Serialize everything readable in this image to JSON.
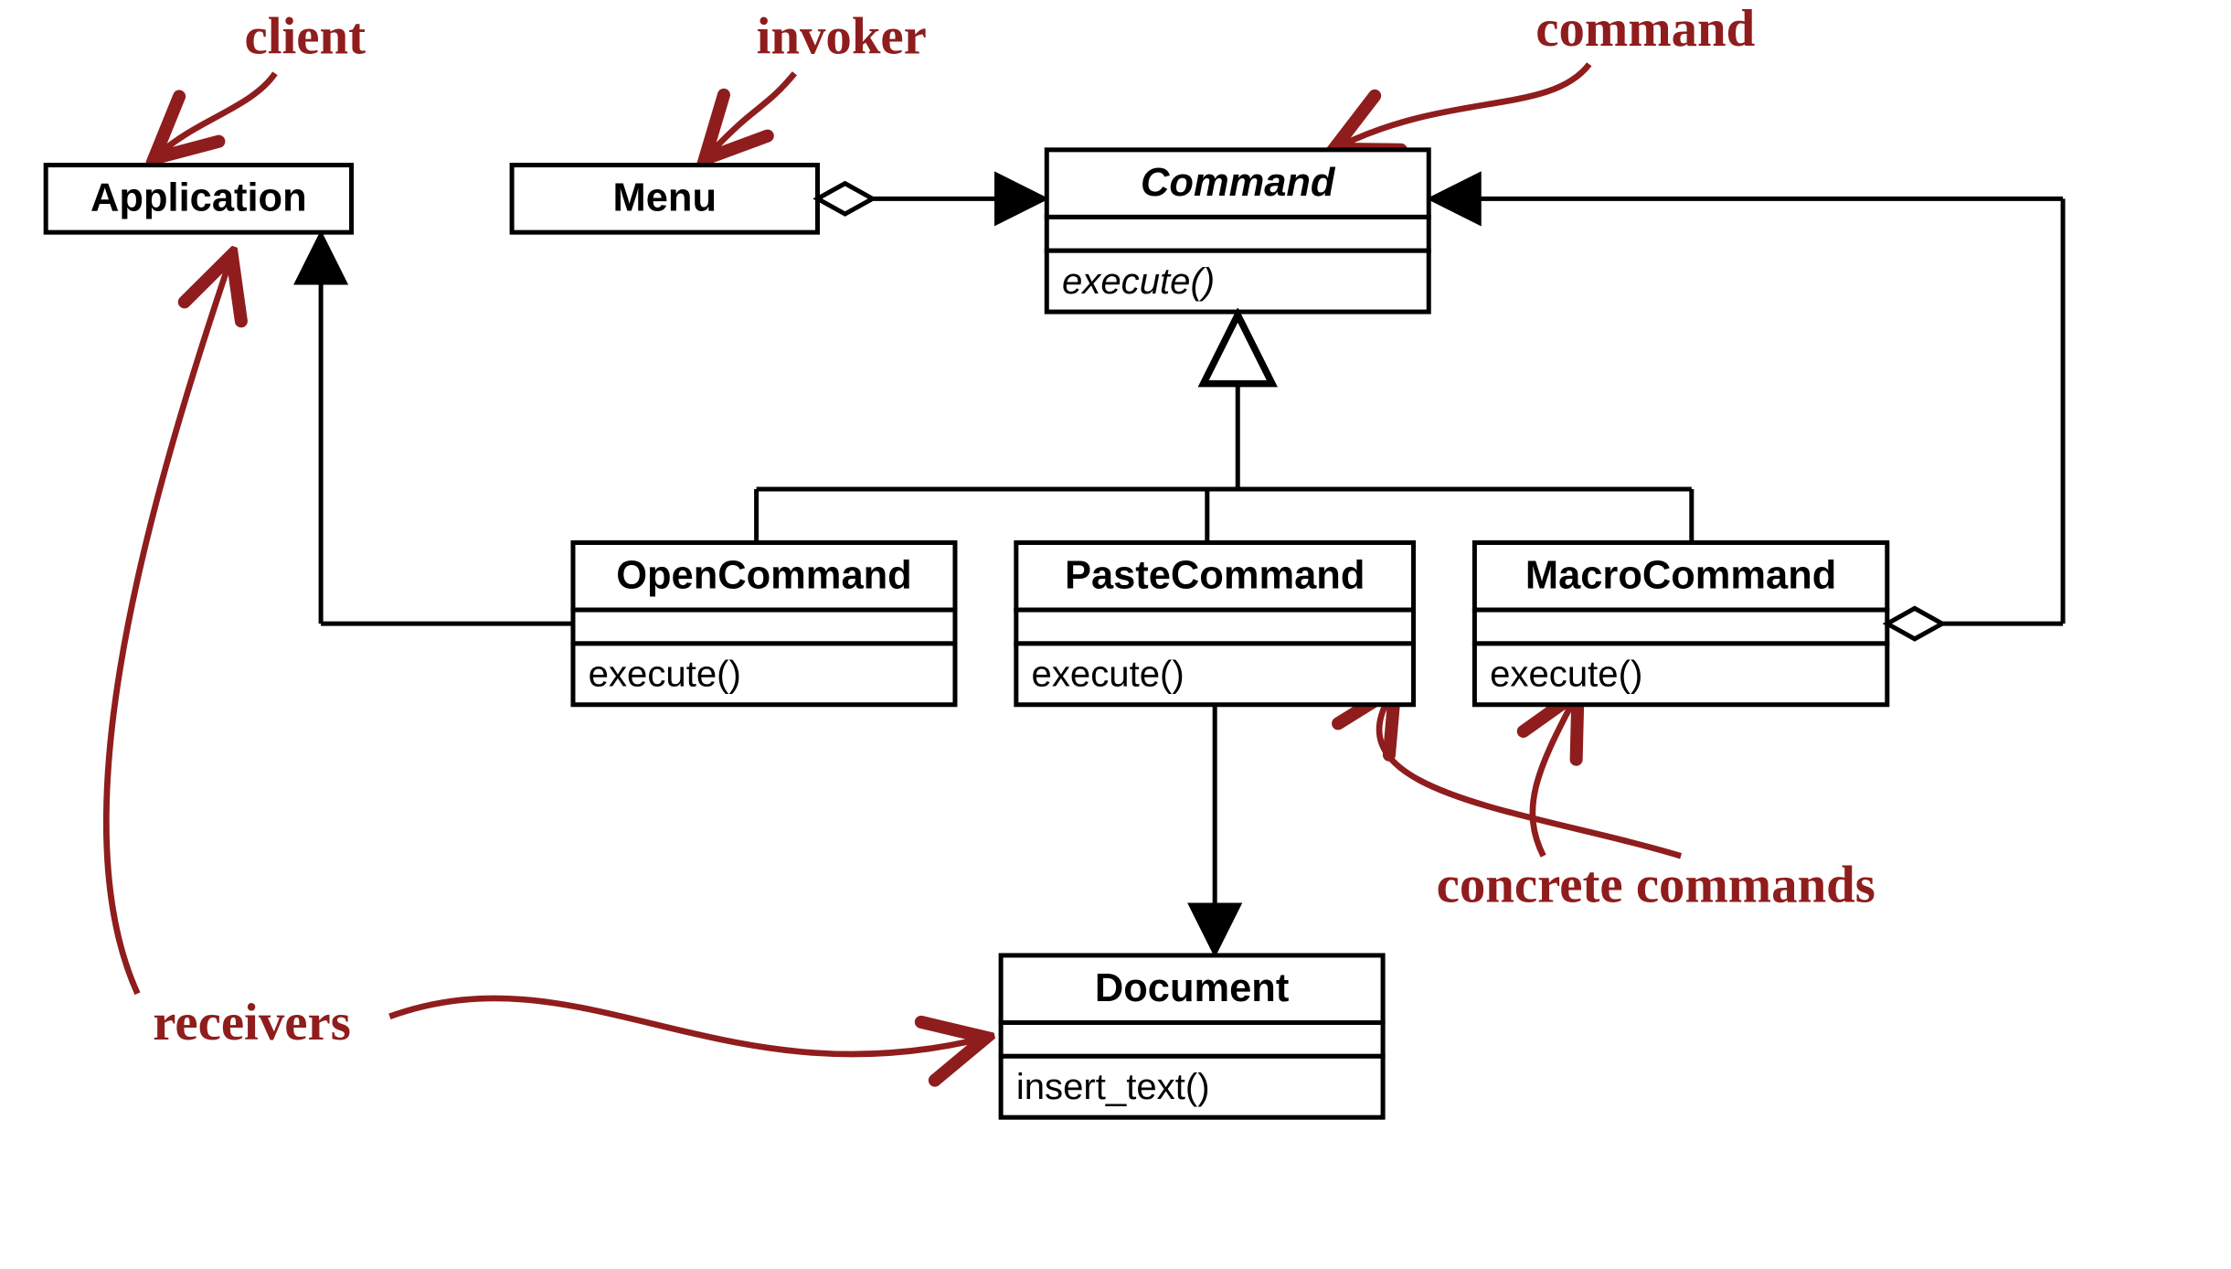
{
  "annotations": {
    "client": "client",
    "invoker": "invoker",
    "command": "command",
    "concrete": "concrete commands",
    "receivers": "receivers"
  },
  "boxes": {
    "application": {
      "name": "Application"
    },
    "menu": {
      "name": "Menu"
    },
    "command": {
      "name": "Command",
      "method": "execute()"
    },
    "openCommand": {
      "name": "OpenCommand",
      "method": "execute()"
    },
    "pasteCommand": {
      "name": "PasteCommand",
      "method": "execute()"
    },
    "macroCommand": {
      "name": "MacroCommand",
      "method": "execute()"
    },
    "document": {
      "name": "Document",
      "method": "insert_text()"
    }
  },
  "relationships": [
    {
      "from": "Menu",
      "to": "Command",
      "type": "aggregation"
    },
    {
      "from": "OpenCommand",
      "to": "Command",
      "type": "inheritance"
    },
    {
      "from": "PasteCommand",
      "to": "Command",
      "type": "inheritance"
    },
    {
      "from": "MacroCommand",
      "to": "Command",
      "type": "inheritance"
    },
    {
      "from": "MacroCommand",
      "to": "Command",
      "type": "aggregation"
    },
    {
      "from": "OpenCommand",
      "to": "Application",
      "type": "association"
    },
    {
      "from": "PasteCommand",
      "to": "Document",
      "type": "association"
    }
  ]
}
